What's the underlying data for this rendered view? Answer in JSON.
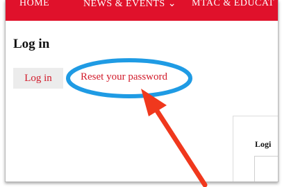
{
  "navbar": {
    "items": [
      "HOME",
      "NEWS & EVENTS",
      "MTAC & EDUCAT"
    ],
    "dropdown_marker": "⌄",
    "color": "#e0112b"
  },
  "page": {
    "title": "Log in"
  },
  "tabs": [
    {
      "label": "Log in",
      "active": true
    },
    {
      "label": "Reset your password",
      "active": false
    }
  ],
  "login_form": {
    "label": "Logi"
  },
  "annotation": {
    "ellipse_color": "#1f9be4",
    "arrow_color": "#f0381d"
  }
}
